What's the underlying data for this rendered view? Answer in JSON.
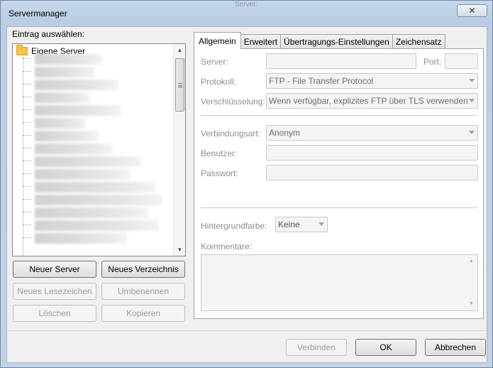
{
  "window": {
    "title": "Servermanager",
    "close_glyph": "✕",
    "background_hint": "Server:"
  },
  "left": {
    "label": "Eintrag auswählen:",
    "root_item": "Eigene Server",
    "buttons": {
      "new_server": "Neuer Server",
      "new_folder": "Neues Verzeichnis",
      "new_bookmark": "Neues Lesezeichen",
      "rename": "Umbenennen",
      "delete": "Löschen",
      "copy": "Kopieren"
    }
  },
  "tabs": [
    {
      "label": "Allgemein",
      "active": true
    },
    {
      "label": "Erweitert",
      "active": false
    },
    {
      "label": "Übertragungs-Einstellungen",
      "active": false
    },
    {
      "label": "Zeichensatz",
      "active": false
    }
  ],
  "form": {
    "server_label": "Server:",
    "server_value": "",
    "port_label": "Port:",
    "port_value": "",
    "protocol_label": "Protokoll:",
    "protocol_value": "FTP - File Transfer Protocol",
    "encryption_label": "Verschlüsselung:",
    "encryption_value": "Wenn verfügbar, explizites FTP über TLS verwenden",
    "logon_label": "Verbindungsart:",
    "logon_value": "Anonym",
    "user_label": "Benutzer:",
    "user_value": "",
    "password_label": "Passwort:",
    "password_value": "",
    "bgcolor_label": "Hintergrundfarbe:",
    "bgcolor_value": "Keine",
    "comments_label": "Kommentare:",
    "comments_value": ""
  },
  "footer": {
    "connect": "Verbinden",
    "ok": "OK",
    "cancel": "Abbrechen"
  },
  "colors": {
    "folder": "#f4c443",
    "disabled_text": "#8d8d8d"
  }
}
